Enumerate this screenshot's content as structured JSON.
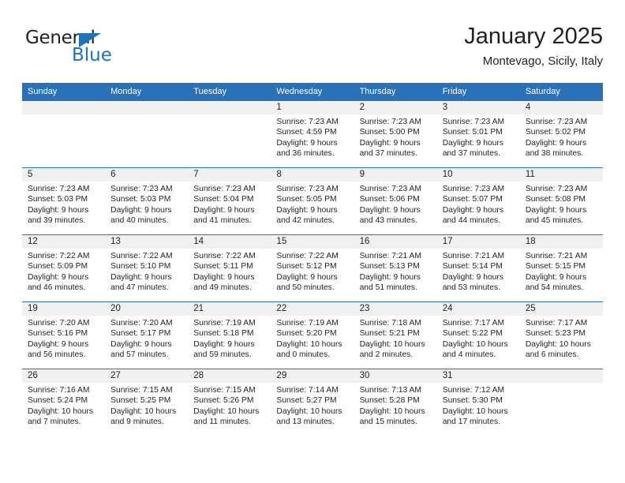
{
  "brand": {
    "word_one": "General",
    "word_two": "Blue",
    "triangle_icon": "triangle-icon",
    "accent_color": "#1e74bb"
  },
  "header": {
    "title": "January 2025",
    "subtitle": "Montevago, Sicily, Italy"
  },
  "theme": {
    "header_blue": "#2b71b8",
    "band_gray": "#f0f0f0",
    "text": "#231f20"
  },
  "weekday_headers": [
    "Sunday",
    "Monday",
    "Tuesday",
    "Wednesday",
    "Thursday",
    "Friday",
    "Saturday"
  ],
  "weeks": [
    [
      {
        "day": "",
        "sunrise": "",
        "sunset": "",
        "daylight_line1": "",
        "daylight_line2": ""
      },
      {
        "day": "",
        "sunrise": "",
        "sunset": "",
        "daylight_line1": "",
        "daylight_line2": ""
      },
      {
        "day": "",
        "sunrise": "",
        "sunset": "",
        "daylight_line1": "",
        "daylight_line2": ""
      },
      {
        "day": "1",
        "sunrise": "Sunrise: 7:23 AM",
        "sunset": "Sunset: 4:59 PM",
        "daylight_line1": "Daylight: 9 hours",
        "daylight_line2": "and 36 minutes."
      },
      {
        "day": "2",
        "sunrise": "Sunrise: 7:23 AM",
        "sunset": "Sunset: 5:00 PM",
        "daylight_line1": "Daylight: 9 hours",
        "daylight_line2": "and 37 minutes."
      },
      {
        "day": "3",
        "sunrise": "Sunrise: 7:23 AM",
        "sunset": "Sunset: 5:01 PM",
        "daylight_line1": "Daylight: 9 hours",
        "daylight_line2": "and 37 minutes."
      },
      {
        "day": "4",
        "sunrise": "Sunrise: 7:23 AM",
        "sunset": "Sunset: 5:02 PM",
        "daylight_line1": "Daylight: 9 hours",
        "daylight_line2": "and 38 minutes."
      }
    ],
    [
      {
        "day": "5",
        "sunrise": "Sunrise: 7:23 AM",
        "sunset": "Sunset: 5:03 PM",
        "daylight_line1": "Daylight: 9 hours",
        "daylight_line2": "and 39 minutes."
      },
      {
        "day": "6",
        "sunrise": "Sunrise: 7:23 AM",
        "sunset": "Sunset: 5:03 PM",
        "daylight_line1": "Daylight: 9 hours",
        "daylight_line2": "and 40 minutes."
      },
      {
        "day": "7",
        "sunrise": "Sunrise: 7:23 AM",
        "sunset": "Sunset: 5:04 PM",
        "daylight_line1": "Daylight: 9 hours",
        "daylight_line2": "and 41 minutes."
      },
      {
        "day": "8",
        "sunrise": "Sunrise: 7:23 AM",
        "sunset": "Sunset: 5:05 PM",
        "daylight_line1": "Daylight: 9 hours",
        "daylight_line2": "and 42 minutes."
      },
      {
        "day": "9",
        "sunrise": "Sunrise: 7:23 AM",
        "sunset": "Sunset: 5:06 PM",
        "daylight_line1": "Daylight: 9 hours",
        "daylight_line2": "and 43 minutes."
      },
      {
        "day": "10",
        "sunrise": "Sunrise: 7:23 AM",
        "sunset": "Sunset: 5:07 PM",
        "daylight_line1": "Daylight: 9 hours",
        "daylight_line2": "and 44 minutes."
      },
      {
        "day": "11",
        "sunrise": "Sunrise: 7:23 AM",
        "sunset": "Sunset: 5:08 PM",
        "daylight_line1": "Daylight: 9 hours",
        "daylight_line2": "and 45 minutes."
      }
    ],
    [
      {
        "day": "12",
        "sunrise": "Sunrise: 7:22 AM",
        "sunset": "Sunset: 5:09 PM",
        "daylight_line1": "Daylight: 9 hours",
        "daylight_line2": "and 46 minutes."
      },
      {
        "day": "13",
        "sunrise": "Sunrise: 7:22 AM",
        "sunset": "Sunset: 5:10 PM",
        "daylight_line1": "Daylight: 9 hours",
        "daylight_line2": "and 47 minutes."
      },
      {
        "day": "14",
        "sunrise": "Sunrise: 7:22 AM",
        "sunset": "Sunset: 5:11 PM",
        "daylight_line1": "Daylight: 9 hours",
        "daylight_line2": "and 49 minutes."
      },
      {
        "day": "15",
        "sunrise": "Sunrise: 7:22 AM",
        "sunset": "Sunset: 5:12 PM",
        "daylight_line1": "Daylight: 9 hours",
        "daylight_line2": "and 50 minutes."
      },
      {
        "day": "16",
        "sunrise": "Sunrise: 7:21 AM",
        "sunset": "Sunset: 5:13 PM",
        "daylight_line1": "Daylight: 9 hours",
        "daylight_line2": "and 51 minutes."
      },
      {
        "day": "17",
        "sunrise": "Sunrise: 7:21 AM",
        "sunset": "Sunset: 5:14 PM",
        "daylight_line1": "Daylight: 9 hours",
        "daylight_line2": "and 53 minutes."
      },
      {
        "day": "18",
        "sunrise": "Sunrise: 7:21 AM",
        "sunset": "Sunset: 5:15 PM",
        "daylight_line1": "Daylight: 9 hours",
        "daylight_line2": "and 54 minutes."
      }
    ],
    [
      {
        "day": "19",
        "sunrise": "Sunrise: 7:20 AM",
        "sunset": "Sunset: 5:16 PM",
        "daylight_line1": "Daylight: 9 hours",
        "daylight_line2": "and 56 minutes."
      },
      {
        "day": "20",
        "sunrise": "Sunrise: 7:20 AM",
        "sunset": "Sunset: 5:17 PM",
        "daylight_line1": "Daylight: 9 hours",
        "daylight_line2": "and 57 minutes."
      },
      {
        "day": "21",
        "sunrise": "Sunrise: 7:19 AM",
        "sunset": "Sunset: 5:18 PM",
        "daylight_line1": "Daylight: 9 hours",
        "daylight_line2": "and 59 minutes."
      },
      {
        "day": "22",
        "sunrise": "Sunrise: 7:19 AM",
        "sunset": "Sunset: 5:20 PM",
        "daylight_line1": "Daylight: 10 hours",
        "daylight_line2": "and 0 minutes."
      },
      {
        "day": "23",
        "sunrise": "Sunrise: 7:18 AM",
        "sunset": "Sunset: 5:21 PM",
        "daylight_line1": "Daylight: 10 hours",
        "daylight_line2": "and 2 minutes."
      },
      {
        "day": "24",
        "sunrise": "Sunrise: 7:17 AM",
        "sunset": "Sunset: 5:22 PM",
        "daylight_line1": "Daylight: 10 hours",
        "daylight_line2": "and 4 minutes."
      },
      {
        "day": "25",
        "sunrise": "Sunrise: 7:17 AM",
        "sunset": "Sunset: 5:23 PM",
        "daylight_line1": "Daylight: 10 hours",
        "daylight_line2": "and 6 minutes."
      }
    ],
    [
      {
        "day": "26",
        "sunrise": "Sunrise: 7:16 AM",
        "sunset": "Sunset: 5:24 PM",
        "daylight_line1": "Daylight: 10 hours",
        "daylight_line2": "and 7 minutes."
      },
      {
        "day": "27",
        "sunrise": "Sunrise: 7:15 AM",
        "sunset": "Sunset: 5:25 PM",
        "daylight_line1": "Daylight: 10 hours",
        "daylight_line2": "and 9 minutes."
      },
      {
        "day": "28",
        "sunrise": "Sunrise: 7:15 AM",
        "sunset": "Sunset: 5:26 PM",
        "daylight_line1": "Daylight: 10 hours",
        "daylight_line2": "and 11 minutes."
      },
      {
        "day": "29",
        "sunrise": "Sunrise: 7:14 AM",
        "sunset": "Sunset: 5:27 PM",
        "daylight_line1": "Daylight: 10 hours",
        "daylight_line2": "and 13 minutes."
      },
      {
        "day": "30",
        "sunrise": "Sunrise: 7:13 AM",
        "sunset": "Sunset: 5:28 PM",
        "daylight_line1": "Daylight: 10 hours",
        "daylight_line2": "and 15 minutes."
      },
      {
        "day": "31",
        "sunrise": "Sunrise: 7:12 AM",
        "sunset": "Sunset: 5:30 PM",
        "daylight_line1": "Daylight: 10 hours",
        "daylight_line2": "and 17 minutes."
      },
      {
        "day": "",
        "sunrise": "",
        "sunset": "",
        "daylight_line1": "",
        "daylight_line2": ""
      }
    ]
  ]
}
